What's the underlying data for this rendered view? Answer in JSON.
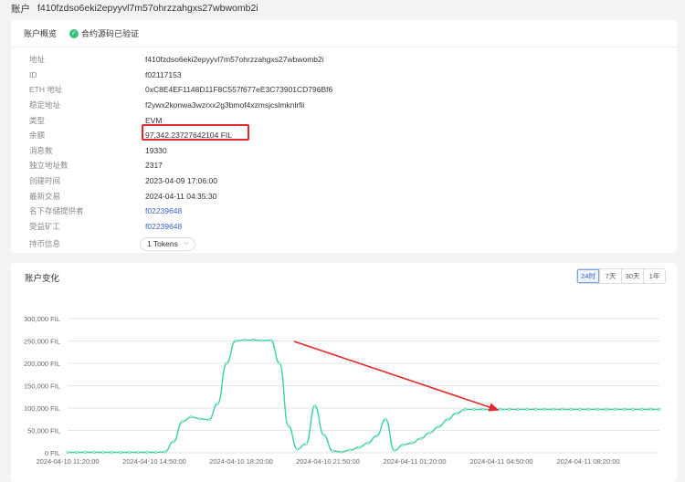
{
  "header": {
    "label": "账户",
    "address": "f410fzdso6eki2epyyvl7m57ohrzzahgxs27wbwomb2i"
  },
  "overview": {
    "tab_label": "账户概览",
    "verified_label": "合约源码已验证",
    "rows": [
      {
        "key": "地址",
        "value": "f410fzdso6eki2epyyvl7m57ohrzzahgxs27wbwomb2i",
        "link": false
      },
      {
        "key": "ID",
        "value": "f02117153",
        "link": false
      },
      {
        "key": "ETH 地址",
        "value": "0xC8E4EF1148D11F8C557f677eE3C73901CD796Bf6",
        "link": false
      },
      {
        "key": "稳定地址",
        "value": "f2ywx2konwa3wzrxx2g3bmof4xzmsjcslmknlrfii",
        "link": false
      },
      {
        "key": "类型",
        "value": "EVM",
        "link": false
      },
      {
        "key": "余额",
        "value": "97,342.23727642104 FIL",
        "link": false
      },
      {
        "key": "消息数",
        "value": "19330",
        "link": false
      },
      {
        "key": "独立地址数",
        "value": "2317",
        "link": false
      },
      {
        "key": "创建时间",
        "value": "2023-04-09 17:06:00",
        "link": false
      },
      {
        "key": "最新交易",
        "value": "2024-04-11 04:35:30",
        "link": false
      },
      {
        "key": "名下存储提供者",
        "value": "f02239648",
        "link": true
      },
      {
        "key": "受益矿工",
        "value": "f02239648",
        "link": true
      }
    ],
    "token_key": "持币信息",
    "token_value": "1 Tokens"
  },
  "chart": {
    "title": "账户变化",
    "ranges": [
      "24时",
      "7天",
      "30天",
      "1年"
    ],
    "active_range": 0,
    "colors": {
      "line": "#3ecfa8",
      "arrow": "#e2282a",
      "grid": "#e6e6e6"
    }
  },
  "chart_data": {
    "type": "line",
    "ylim": [
      0,
      300000
    ],
    "y_ticks": [
      "0 FIL",
      "50,000 FIL",
      "100,000 FIL",
      "150,000 FIL",
      "200,000 FIL",
      "250,000 FIL",
      "300,000 FIL"
    ],
    "x_ticks": [
      "2024-04-10 11:20:00",
      "2024-04-10 14:50:00",
      "2024-04-10 18:20:00",
      "2024-04-10 21:50:00",
      "2024-04-11 01:20:00",
      "2024-04-11 04:50:00",
      "2024-04-11 08:20:00"
    ],
    "series": [
      {
        "x": [
          0,
          0.1,
          0.2,
          0.3,
          0.4,
          0.5,
          0.6,
          0.7,
          0.8,
          0.9,
          1.0,
          1.1,
          1.2,
          1.3,
          1.4,
          1.5,
          1.6,
          1.7,
          1.8,
          1.9,
          2.0,
          2.1,
          2.2,
          2.3,
          2.4,
          2.5,
          2.6,
          2.7,
          2.8,
          2.9,
          3.0,
          3.1,
          3.2,
          3.3,
          3.4,
          3.5,
          3.6,
          3.7,
          3.8,
          3.9,
          4.0,
          4.1,
          4.2,
          4.3,
          4.4,
          4.5,
          4.6,
          4.7,
          4.8,
          4.9,
          5.0,
          5.1,
          5.2,
          5.3,
          5.4,
          5.5,
          5.6,
          5.7,
          5.8,
          5.9,
          6.0,
          6.1,
          6.2,
          6.3,
          6.4,
          6.5,
          6.6,
          6.7
        ],
        "values": [
          1000,
          1000,
          1000,
          1000,
          1000,
          1000,
          1000,
          1000,
          1000,
          1000,
          1000,
          2000,
          25000,
          70000,
          80000,
          76000,
          74000,
          110000,
          200000,
          250000,
          252000,
          252000,
          251000,
          252000,
          200000,
          60000,
          8000,
          20000,
          105000,
          40000,
          4000,
          2000,
          6000,
          12000,
          22000,
          38000,
          75000,
          5000,
          18000,
          22000,
          32000,
          45000,
          58000,
          74000,
          88000,
          97000,
          97000,
          97000,
          97000,
          97000,
          97000,
          97000,
          97000,
          97000,
          97000,
          97000,
          97000,
          97000,
          97000,
          97000,
          97000,
          97000,
          97000,
          97000,
          97000,
          97000,
          97000,
          97000
        ]
      }
    ]
  }
}
